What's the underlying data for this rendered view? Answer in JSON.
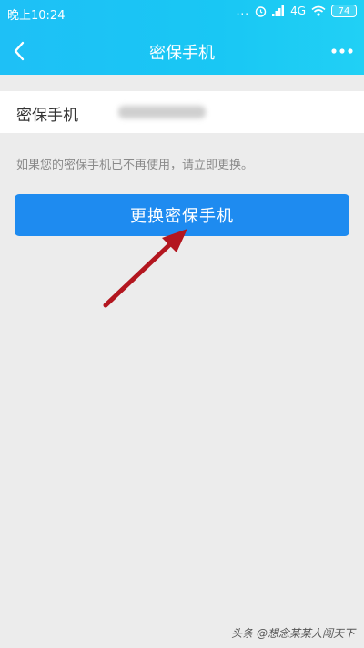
{
  "status_bar": {
    "time": "晚上10:24",
    "dots": "...",
    "network": "4G",
    "battery": "74"
  },
  "header": {
    "title": "密保手机"
  },
  "phone_row": {
    "label": "密保手机"
  },
  "hint": "如果您的密保手机已不再使用，请立即更换。",
  "primary_button": {
    "label": "更换密保手机"
  },
  "watermark": "头条 @想念某某人闯天下",
  "colors": {
    "header": "#1ec0f6",
    "button": "#1e8bf0",
    "arrow": "#b3161f"
  }
}
